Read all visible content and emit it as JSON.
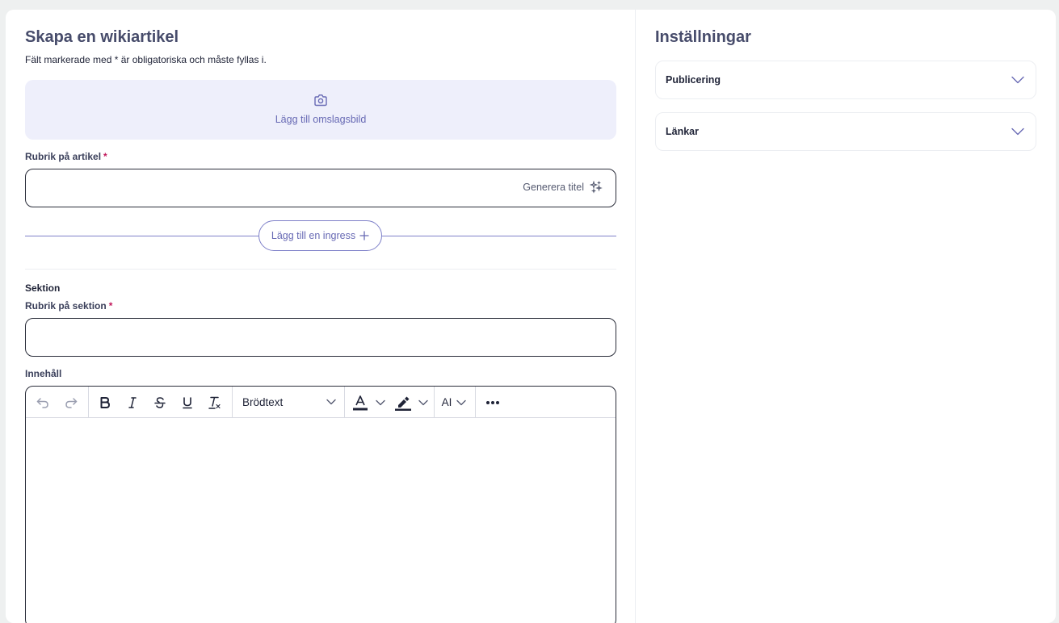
{
  "main": {
    "title": "Skapa en wikiartikel",
    "required_hint": "Fält markerade med * är obligatoriska och måste fyllas i.",
    "cover_label": "Lägg till omslagsbild",
    "article_title_label": "Rubrik på artikel",
    "article_title_value": "",
    "generate_title": "Generera titel",
    "add_ingress": "Lägg till en ingress",
    "section_heading": "Sektion",
    "section_title_label": "Rubrik på sektion",
    "section_title_value": "",
    "content_label": "Innehåll",
    "required_marker": "*"
  },
  "editor": {
    "format_select": "Brödtext",
    "ai_label": "AI",
    "text_color": "#1f2337",
    "highlight_color": "#1f2337"
  },
  "sidebar": {
    "title": "Inställningar",
    "sections": [
      {
        "label": "Publicering"
      },
      {
        "label": "Länkar"
      }
    ]
  },
  "colors": {
    "accent": "#6769b4",
    "heading": "#474c6b",
    "cover_bg": "#eeeffb",
    "required": "#c2185b"
  }
}
